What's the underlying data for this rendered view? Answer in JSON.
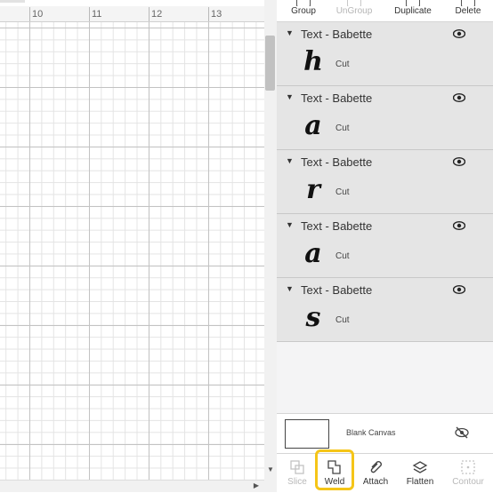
{
  "ruler": {
    "labels": [
      "10",
      "11",
      "12",
      "13"
    ]
  },
  "toolbar": {
    "group": "Group",
    "ungroup": "UnGroup",
    "duplicate": "Duplicate",
    "delete": "Delete"
  },
  "layers": [
    {
      "title": "Text - Babette",
      "glyph": "h",
      "operation": "Cut"
    },
    {
      "title": "Text - Babette",
      "glyph": "a",
      "operation": "Cut"
    },
    {
      "title": "Text - Babette",
      "glyph": "r",
      "operation": "Cut"
    },
    {
      "title": "Text - Babette",
      "glyph": "a",
      "operation": "Cut"
    },
    {
      "title": "Text - Babette",
      "glyph": "s",
      "operation": "Cut"
    }
  ],
  "blank_canvas": {
    "label": "Blank Canvas"
  },
  "bottom_toolbar": {
    "slice": "Slice",
    "weld": "Weld",
    "attach": "Attach",
    "flatten": "Flatten",
    "contour": "Contour"
  },
  "colors": {
    "highlight": "#f5c518",
    "layer_bg": "#e5e5e5"
  }
}
